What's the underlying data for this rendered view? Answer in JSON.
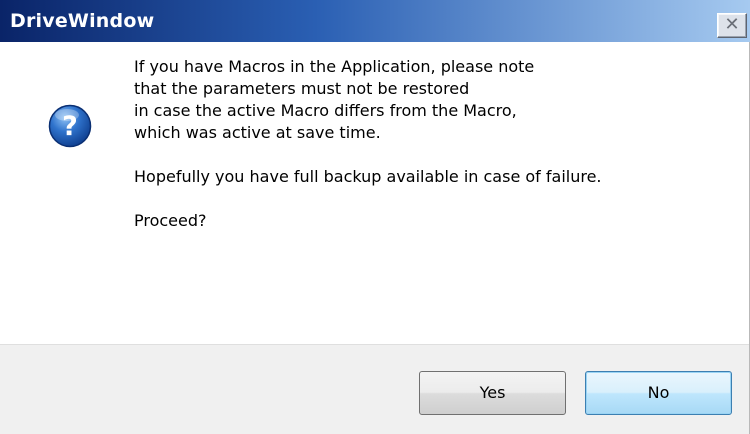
{
  "window": {
    "title": "DriveWindow",
    "close_glyph": "✕"
  },
  "icon": {
    "name": "question-icon",
    "glyph": "?",
    "color": "#1b58b0"
  },
  "message": {
    "lines": [
      "If you have Macros in the Application, please note",
      "that the parameters must not be restored",
      "in case the active Macro differs from the Macro,",
      "which was active at save time."
    ],
    "backup_note": "Hopefully you have full backup available in case of failure.",
    "prompt": "Proceed?"
  },
  "buttons": {
    "yes_label": "Yes",
    "no_label": "No"
  },
  "colors": {
    "title_bar_start": "#0a2468",
    "title_bar_end": "#a6caf0",
    "footer_bg": "#f0f0f0",
    "default_button_border": "#3c7fb1"
  }
}
